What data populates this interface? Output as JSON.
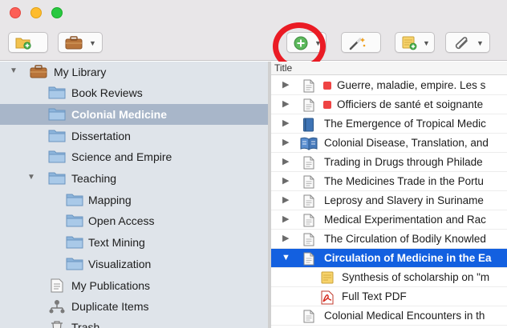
{
  "colors": {
    "selection_blue": "#1360e0",
    "sidebar_selected": "#a8b6c9",
    "tag_red": "#ef4444",
    "annotation_ring": "#ea1b24"
  },
  "toolbar": {
    "buttons": [
      {
        "name": "new-collection",
        "icon": "folder-add-icon"
      },
      {
        "name": "library-menu",
        "icon": "briefcase-icon"
      },
      {
        "name": "new-item",
        "icon": "plus-circle-icon"
      },
      {
        "name": "add-by-identifier",
        "icon": "magic-wand-icon"
      },
      {
        "name": "new-note",
        "icon": "note-add-icon"
      },
      {
        "name": "add-attachment",
        "icon": "paperclip-icon"
      }
    ]
  },
  "sidebar": {
    "library": "My Library",
    "collections": [
      {
        "label": "Book Reviews"
      },
      {
        "label": "Colonial Medicine",
        "selected": true
      },
      {
        "label": "Dissertation"
      },
      {
        "label": "Science and Empire"
      },
      {
        "label": "Teaching"
      },
      {
        "label": "Mapping"
      },
      {
        "label": "Open Access"
      },
      {
        "label": "Text Mining"
      },
      {
        "label": "Visualization"
      }
    ],
    "my_publications": "My Publications",
    "duplicate_items": "Duplicate Items",
    "trash": "Trash"
  },
  "items": {
    "column_title": "Title",
    "rows": [
      {
        "title": "Guerre, maladie, empire. Les s",
        "icon": "document-icon",
        "tag": "red"
      },
      {
        "title": "Officiers de santé et soignante",
        "icon": "document-icon",
        "tag": "red"
      },
      {
        "title": "The Emergence of Tropical Medic",
        "icon": "book-icon"
      },
      {
        "title": "Colonial Disease, Translation, and",
        "icon": "book-section-icon"
      },
      {
        "title": "Trading in Drugs through Philade",
        "icon": "document-icon"
      },
      {
        "title": "The Medicines Trade in the Portu",
        "icon": "document-icon"
      },
      {
        "title": "Leprosy and Slavery in Suriname",
        "icon": "document-icon"
      },
      {
        "title": "Medical Experimentation and Rac",
        "icon": "document-icon"
      },
      {
        "title": "The Circulation of Bodily Knowled",
        "icon": "document-icon"
      },
      {
        "title": "Circulation of Medicine in the Ea",
        "icon": "document-icon",
        "selected": true,
        "expanded": true
      },
      {
        "title": "Synthesis of scholarship on \"m",
        "icon": "note-icon",
        "child": true
      },
      {
        "title": "Full Text PDF",
        "icon": "pdf-icon",
        "child": true
      },
      {
        "title": "Colonial Medical Encounters in th",
        "icon": "document-icon"
      }
    ]
  }
}
